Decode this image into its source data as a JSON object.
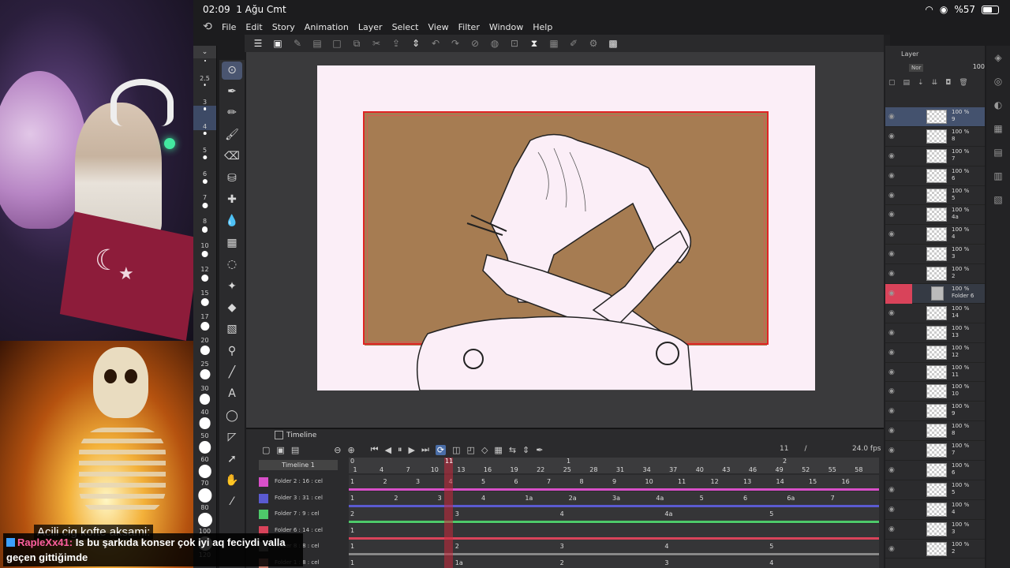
{
  "status_bar": {
    "time": "02:09",
    "date": "1 Ağu Cmt",
    "battery": "%57",
    "wifi_icon": "wifi-icon"
  },
  "menu": [
    "File",
    "Edit",
    "Story",
    "Animation",
    "Layer",
    "Select",
    "View",
    "Filter",
    "Window",
    "Help"
  ],
  "brush_sizes": [
    "2.5",
    "3",
    "4",
    "5",
    "6",
    "7",
    "8",
    "10",
    "12",
    "15",
    "17",
    "20",
    "25",
    "30",
    "40",
    "50",
    "60",
    "70",
    "80",
    "100",
    "120"
  ],
  "brush_selected_index": 2,
  "tools": [
    "move-icon",
    "pen-icon",
    "pencil-icon",
    "brush-icon",
    "eraser-icon",
    "fill-bucket-icon",
    "decoration-icon",
    "blend-icon",
    "grid-icon",
    "lasso-icon",
    "magic-wand-icon",
    "fill-icon",
    "gradient-icon",
    "eyedropper-icon",
    "line-icon",
    "text-icon",
    "balloon-icon",
    "ruler-icon",
    "object-icon",
    "hand-icon",
    "color-picker-icon"
  ],
  "timeline": {
    "tab_label": "Timeline",
    "name": "Timeline 1",
    "current_frame": "11",
    "fps": "24.0 fps",
    "ruler_top": [
      {
        "label": "0",
        "pos": 0
      },
      {
        "label": "1",
        "pos": 125
      },
      {
        "label": "1",
        "pos": 274
      },
      {
        "label": "2",
        "pos": 548
      }
    ],
    "ruler": [
      "1",
      "4",
      "7",
      "10",
      "13",
      "16",
      "19",
      "22",
      "25",
      "28",
      "31",
      "34",
      "37",
      "40",
      "43",
      "46",
      "49",
      "52",
      "55",
      "58"
    ],
    "tracks": [
      {
        "label": "Folder 2 : 16 : cel",
        "color": "#d84fc9",
        "cels": [
          "1",
          "2",
          "3",
          "4",
          "5",
          "6",
          "7",
          "8",
          "9",
          "10",
          "11",
          "12",
          "13",
          "14",
          "15",
          "16"
        ]
      },
      {
        "label": "Folder 3 : 31 : cel",
        "color": "#5a5ad0",
        "cels": [
          "1",
          "2",
          "3",
          "4",
          "1a",
          "2a",
          "3a",
          "4a",
          "5",
          "6",
          "6a",
          "7"
        ]
      },
      {
        "label": "Folder 7 : 9 : cel",
        "color": "#4ec96a",
        "cels": [
          "2",
          "3",
          "4",
          "4a",
          "5"
        ]
      },
      {
        "label": "Folder 6 : 14 : cel",
        "color": "#d9435a",
        "cels": [
          "1"
        ]
      },
      {
        "label": "Folder 8 : 8 : cel",
        "color": "#888888",
        "cels": [
          "1",
          "2",
          "3",
          "4",
          "5"
        ]
      },
      {
        "label": "Folder 1 : 8 : cel",
        "color": "#c47a6a",
        "cels": [
          "1",
          "1a",
          "2",
          "3",
          "4"
        ]
      }
    ]
  },
  "layers": {
    "tab_label": "Layer",
    "opacity": "100",
    "blend": "Nor",
    "items": [
      {
        "opacity": "100 %",
        "name": "9",
        "selected": true
      },
      {
        "opacity": "100 %",
        "name": "8"
      },
      {
        "opacity": "100 %",
        "name": "7"
      },
      {
        "opacity": "100 %",
        "name": "6"
      },
      {
        "opacity": "100 %",
        "name": "5"
      },
      {
        "opacity": "100 %",
        "name": "4a"
      },
      {
        "opacity": "100 %",
        "name": "4"
      },
      {
        "opacity": "100 %",
        "name": "3"
      },
      {
        "opacity": "100 %",
        "name": "2"
      },
      {
        "opacity": "100 %",
        "name": "Folder 6",
        "folder": true
      },
      {
        "opacity": "100 %",
        "name": "14"
      },
      {
        "opacity": "100 %",
        "name": "13"
      },
      {
        "opacity": "100 %",
        "name": "12"
      },
      {
        "opacity": "100 %",
        "name": "11"
      },
      {
        "opacity": "100 %",
        "name": "10"
      },
      {
        "opacity": "100 %",
        "name": "9"
      },
      {
        "opacity": "100 %",
        "name": "8"
      },
      {
        "opacity": "100 %",
        "name": "7"
      },
      {
        "opacity": "100 %",
        "name": "6"
      },
      {
        "opacity": "100 %",
        "name": "5"
      },
      {
        "opacity": "100 %",
        "name": "4"
      },
      {
        "opacity": "100 %",
        "name": "3"
      },
      {
        "opacity": "100 %",
        "name": "2"
      }
    ]
  },
  "overlay": {
    "meme_caption": "Acili cig kofte aksami:",
    "chat_user": "RapleXx41:",
    "chat_message": " Is bu şarkıda konser çok iyi aq feciydi valla geçen gittiğimde"
  },
  "colors": {
    "accent": "#4a6ea8",
    "frame": "#e02424",
    "canvas_fill": "#a67c52",
    "paper": "#fbeef7"
  }
}
